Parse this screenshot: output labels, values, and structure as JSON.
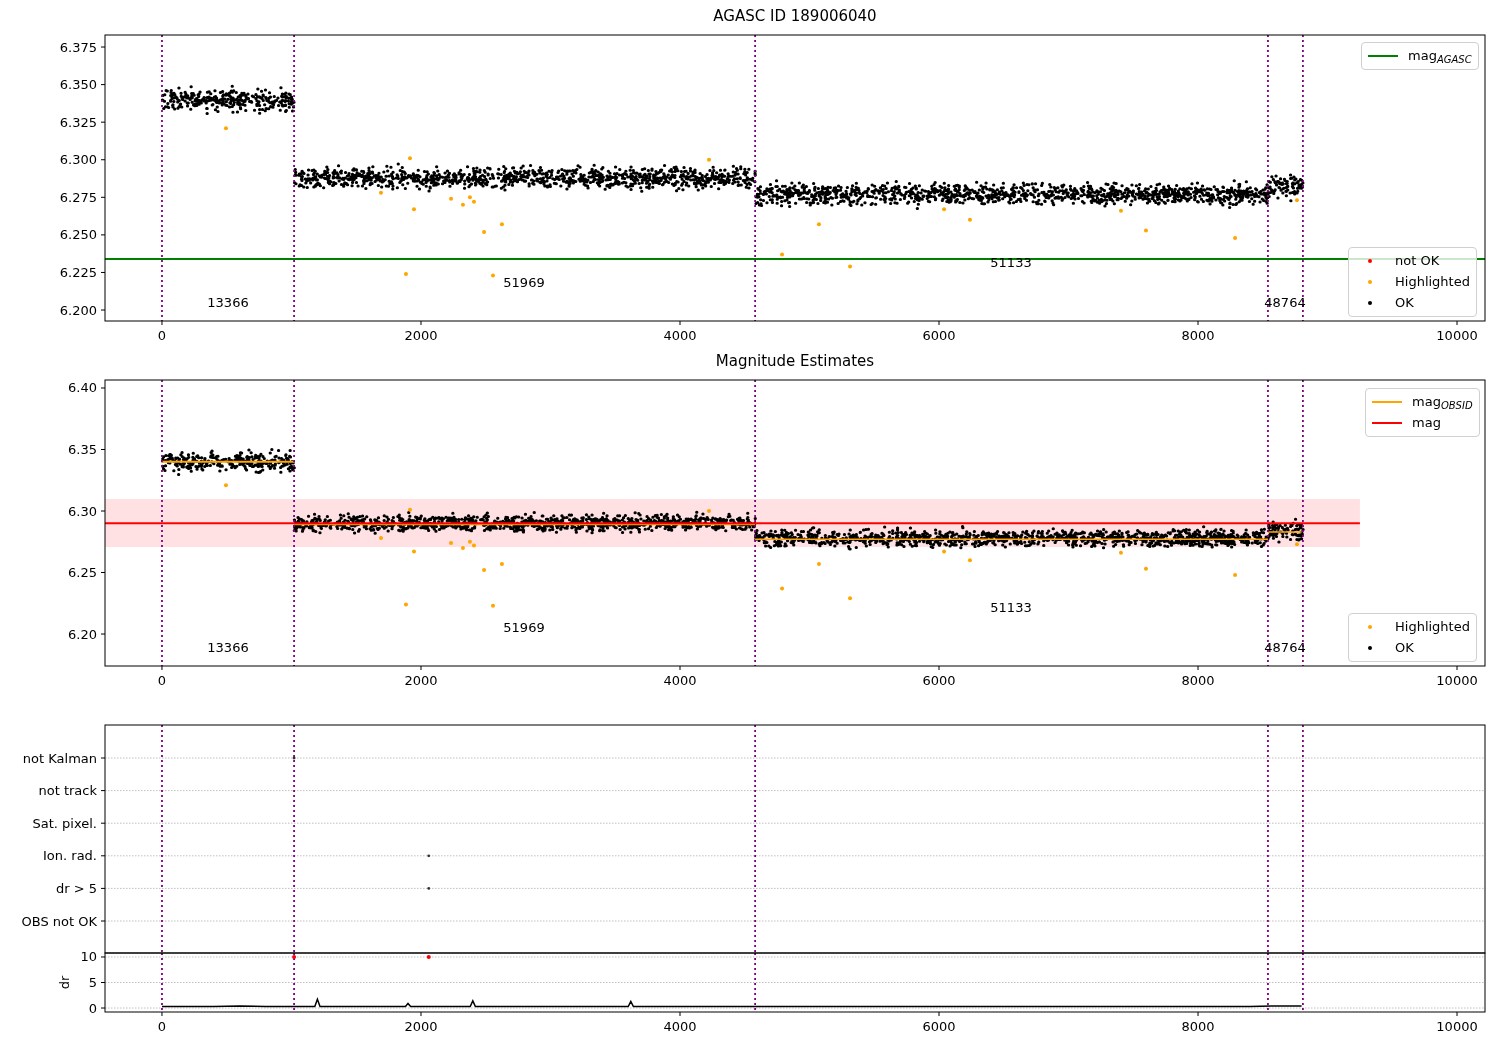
{
  "panels": [
    {
      "chart_data": {
        "type": "scatter",
        "title": "AGASC ID 189006040",
        "xlim": [
          -440,
          10216
        ],
        "ylim": [
          6.1927,
          6.383
        ],
        "xticks": [
          0,
          2000,
          4000,
          6000,
          8000,
          10000
        ],
        "yticks": [
          {
            "value": 6.2,
            "label": "6.200"
          },
          {
            "value": 6.225,
            "label": "6.225"
          },
          {
            "value": 6.25,
            "label": "6.250"
          },
          {
            "value": 6.275,
            "label": "6.275"
          },
          {
            "value": 6.3,
            "label": "6.300"
          },
          {
            "value": 6.325,
            "label": "6.325"
          },
          {
            "value": 6.35,
            "label": "6.350"
          },
          {
            "value": 6.375,
            "label": "6.375"
          }
        ],
        "series": [
          {
            "name": "mag$_{AGASC}$",
            "type": "line",
            "color": "#008000",
            "x": [
              -440,
              10216
            ],
            "values": [
              6.234,
              6.234
            ]
          },
          {
            "name": "not OK",
            "color": "#ff0000"
          },
          {
            "name": "Highlighted",
            "color": "#ffa500",
            "x": [
              494,
              1691,
              1884,
              1915,
              1946,
              2232,
              2324,
              2378,
              2409,
              2487,
              2556,
              2625,
              4224,
              4788,
              5073,
              5313,
              6039,
              6239,
              7405,
              7598,
              8286,
              8764
            ],
            "values": [
              6.321,
              6.278,
              6.224,
              6.301,
              6.267,
              6.274,
              6.27,
              6.275,
              6.272,
              6.252,
              6.223,
              6.257,
              6.3,
              6.237,
              6.257,
              6.229,
              6.267,
              6.26,
              6.266,
              6.253,
              6.248,
              6.273
            ]
          },
          {
            "name": "OK",
            "color": "#000000"
          }
        ],
        "ref_lines": [
          {
            "axis": "x",
            "value": 0,
            "color": "#800080"
          },
          {
            "axis": "x",
            "value": 1020,
            "color": "#800080"
          },
          {
            "axis": "x",
            "value": 4580,
            "color": "#800080"
          },
          {
            "axis": "x",
            "value": 8540,
            "color": "#800080"
          },
          {
            "axis": "x",
            "value": 8810,
            "color": "#800080"
          }
        ],
        "annotations": [
          "13366",
          "51969",
          "51133",
          "48764"
        ]
      }
    },
    {
      "chart_data": {
        "type": "scatter",
        "title": "Magnitude Estimates",
        "xlim": [
          -440,
          10216
        ],
        "ylim": [
          6.174,
          6.4065
        ],
        "xticks": [
          0,
          2000,
          4000,
          6000,
          8000,
          10000
        ],
        "yticks": [
          {
            "value": 6.2,
            "label": "6.20"
          },
          {
            "value": 6.25,
            "label": "6.25"
          },
          {
            "value": 6.3,
            "label": "6.30"
          },
          {
            "value": 6.35,
            "label": "6.35"
          },
          {
            "value": 6.4,
            "label": "6.40"
          }
        ],
        "series": [
          {
            "name": "Highlighted",
            "color": "#ffa500",
            "x": [
              494,
              1691,
              1884,
              1915,
              1946,
              2232,
              2324,
              2378,
              2409,
              2487,
              2556,
              2625,
              4224,
              4788,
              5073,
              5313,
              6039,
              6239,
              7405,
              7598,
              8286,
              8764
            ],
            "values": [
              6.321,
              6.278,
              6.224,
              6.301,
              6.267,
              6.274,
              6.27,
              6.275,
              6.272,
              6.252,
              6.223,
              6.257,
              6.3,
              6.237,
              6.257,
              6.229,
              6.267,
              6.26,
              6.266,
              6.253,
              6.248,
              6.273
            ]
          },
          {
            "name": "OK",
            "color": "#000000"
          },
          {
            "name": "mag$_{OBSID}$",
            "type": "line",
            "color": "#ffa500",
            "x": [
              0,
              1020
            ],
            "values": [
              6.34,
              6.34
            ]
          },
          {
            "type": "line",
            "color": "#ffa500",
            "x": [
              1020,
              4580
            ],
            "values": [
              6.289,
              6.289
            ]
          },
          {
            "type": "line",
            "color": "#ffa500",
            "x": [
              4580,
              8540
            ],
            "values": [
              6.277,
              6.277
            ]
          },
          {
            "type": "line",
            "color": "#ffa500",
            "x": [
              8540,
              8800
            ],
            "values": [
              6.283,
              6.283
            ]
          },
          {
            "name": "mag",
            "type": "line",
            "color": "#ff0000",
            "x": [
              -440,
              9250
            ],
            "values": [
              6.29,
              6.29
            ]
          }
        ],
        "bands": [
          {
            "axis": "y",
            "from": 6.2707,
            "to": 6.3098,
            "color": "#ffe0e3"
          }
        ],
        "ref_lines": [
          {
            "axis": "x",
            "value": 0,
            "color": "#800080"
          },
          {
            "axis": "x",
            "value": 1020,
            "color": "#800080"
          },
          {
            "axis": "x",
            "value": 4580,
            "color": "#800080"
          },
          {
            "axis": "x",
            "value": 8540,
            "color": "#800080"
          },
          {
            "axis": "x",
            "value": 8810,
            "color": "#800080"
          }
        ],
        "annotations": [
          "13366",
          "51969",
          "51133",
          "48764"
        ]
      }
    },
    {
      "flag_rows": [
        "not Kalman",
        "not track",
        "Sat. pixel.",
        "Ion. rad.",
        "dr > 5",
        "OBS not OK"
      ]
    },
    {
      "chart_data": {
        "type": "scatter",
        "ylabel": "dr",
        "grid": true,
        "xlim": [
          -440,
          10216
        ],
        "ylim": [
          -0.78,
          10.78
        ],
        "xticks": [
          0,
          2000,
          4000,
          6000,
          8000,
          10000
        ],
        "yticks": [
          0,
          5,
          10
        ],
        "series": [
          {
            "color": "#ff0000",
            "x": [
              1020,
              2060
            ],
            "values": [
              10,
              10
            ]
          },
          {
            "type": "line",
            "color": "#000000",
            "x": [
              0,
              200,
              400,
              600,
              800,
              1000,
              1180,
              1200,
              1220,
              1400,
              1600,
              1800,
              1880,
              1900,
              1920,
              2000,
              2200,
              2380,
              2400,
              2420,
              2600,
              2800,
              3000,
              3200,
              3400,
              3600,
              3620,
              3640,
              3800,
              4000,
              4200,
              4400,
              4600,
              4800,
              5000,
              5200,
              5400,
              5600,
              5800,
              6000,
              6200,
              6400,
              6600,
              6800,
              7000,
              7200,
              7400,
              7600,
              7800,
              8000,
              8200,
              8400,
              8600,
              8800
            ],
            "values": [
              0.3,
              0.3,
              0.3,
              0.4,
              0.3,
              0.3,
              0.3,
              1.7,
              0.3,
              0.3,
              0.3,
              0.3,
              0.3,
              0.9,
              0.3,
              0.3,
              0.3,
              0.3,
              1.4,
              0.3,
              0.3,
              0.3,
              0.3,
              0.3,
              0.3,
              0.3,
              1.3,
              0.3,
              0.3,
              0.3,
              0.3,
              0.3,
              0.3,
              0.3,
              0.3,
              0.3,
              0.3,
              0.3,
              0.3,
              0.3,
              0.3,
              0.3,
              0.3,
              0.3,
              0.3,
              0.3,
              0.3,
              0.3,
              0.3,
              0.3,
              0.3,
              0.3,
              0.4,
              0.4
            ]
          }
        ],
        "ref_lines": [
          {
            "axis": "x",
            "value": 0,
            "color": "#800080"
          },
          {
            "axis": "x",
            "value": 1020,
            "color": "#800080"
          },
          {
            "axis": "x",
            "value": 4580,
            "color": "#800080"
          },
          {
            "axis": "x",
            "value": 8540,
            "color": "#800080"
          },
          {
            "axis": "x",
            "value": 8810,
            "color": "#800080"
          }
        ]
      }
    }
  ]
}
